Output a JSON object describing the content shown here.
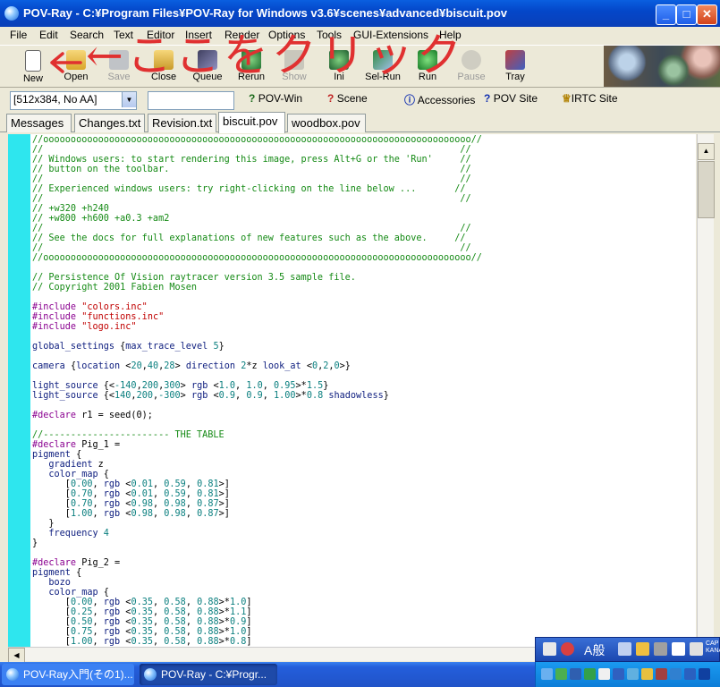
{
  "window": {
    "title": "POV-Ray - C:¥Program Files¥POV-Ray for Windows v3.6¥scenes¥advanced¥biscuit.pov"
  },
  "menu": [
    "File",
    "Edit",
    "Search",
    "Text",
    "Editor",
    "Insert",
    "Render",
    "Options",
    "Tools",
    "GUI-Extensions",
    "Help"
  ],
  "toolbar": {
    "buttons": [
      {
        "label": "New",
        "icon": "new-file-icon",
        "disabled": false
      },
      {
        "label": "Open",
        "icon": "open-folder-icon",
        "disabled": false
      },
      {
        "label": "Save",
        "icon": "save-icon",
        "disabled": true
      },
      {
        "label": "Close",
        "icon": "close-file-icon",
        "disabled": false
      },
      {
        "label": "Queue",
        "icon": "queue-icon",
        "disabled": false
      },
      {
        "label": "Rerun",
        "icon": "rerun-icon",
        "disabled": false
      },
      {
        "label": "Show",
        "icon": "show-icon",
        "disabled": true
      },
      {
        "label": "Ini",
        "icon": "ini-icon",
        "disabled": false
      },
      {
        "label": "Sel-Run",
        "icon": "sel-run-icon",
        "disabled": false
      },
      {
        "label": "Run",
        "icon": "run-icon",
        "disabled": false
      },
      {
        "label": "Pause",
        "icon": "pause-icon",
        "disabled": true
      },
      {
        "label": "Tray",
        "icon": "tray-icon",
        "disabled": false
      }
    ]
  },
  "annotation": {
    "text": "←ここをクリック",
    "color": "#e03030"
  },
  "row2": {
    "resolution": "[512x384, No AA]",
    "command": "",
    "links": [
      "POV-Win",
      "Scene",
      "Accessories",
      "POV Site",
      "IRTC Site"
    ]
  },
  "tabs": [
    "Messages",
    "Changes.txt",
    "Revision.txt",
    "biscuit.pov",
    "woodbox.pov"
  ],
  "active_tab": "biscuit.pov",
  "code_lines": [
    "//oooooooooooooooooooooooooooooooooooooooooooooooooooooooooooooooooooooooooooooo//",
    "//                                                                            //",
    "// Windows users: to start rendering this image, press Alt+G or the 'Run'     //",
    "// button on the toolbar.                                                     //",
    "//                                                                            //",
    "// Experienced windows users: try right-clicking on the line below ...       //",
    "//                                                                            //",
    "// +w320 +h240",
    "// +w800 +h600 +a0.3 +am2",
    "//                                                                            //",
    "// See the docs for full explanations of new features such as the above.     //",
    "//                                                                            //",
    "//oooooooooooooooooooooooooooooooooooooooooooooooooooooooooooooooooooooooooooooo//",
    "",
    "// Persistence Of Vision raytracer version 3.5 sample file.",
    "// Copyright 2001 Fabien Mosen",
    "",
    "#include \"colors.inc\"",
    "#include \"functions.inc\"",
    "#include \"logo.inc\"",
    "",
    "global_settings {max_trace_level 5}",
    "",
    "camera {location <20,40,28> direction 2*z look_at <0,2,0>}",
    "",
    "light_source {<-140,200,300> rgb <1.0, 1.0, 0.95>*1.5}",
    "light_source {<140,200,-300> rgb <0.9, 0.9, 1.00>*0.8 shadowless}",
    "",
    "#declare r1 = seed(0);",
    "",
    "//----------------------- THE TABLE",
    "#declare Pig_1 =",
    "pigment {",
    "   gradient z",
    "   color_map {",
    "      [0.00, rgb <0.01, 0.59, 0.81>]",
    "      [0.70, rgb <0.01, 0.59, 0.81>]",
    "      [0.70, rgb <0.98, 0.98, 0.87>]",
    "      [1.00, rgb <0.98, 0.98, 0.87>]",
    "   }",
    "   frequency 4",
    "}",
    "",
    "#declare Pig_2 =",
    "pigment {",
    "   bozo",
    "   color_map {",
    "      [0.00, rgb <0.35, 0.58, 0.88>*1.0]",
    "      [0.25, rgb <0.35, 0.58, 0.88>*1.1]",
    "      [0.50, rgb <0.35, 0.58, 0.88>*0.9]",
    "      [0.75, rgb <0.35, 0.58, 0.88>*1.0]",
    "      [1.00, rgb <0.35, 0.58, 0.88>*0.8]"
  ],
  "taskbar": {
    "tasks": [
      "POV-Ray入門(その1)...",
      "POV-Ray - C:¥Progr..."
    ],
    "active_task": 1
  },
  "langbar": {
    "ime_label": "A般",
    "side_label": "CAP KANA"
  }
}
